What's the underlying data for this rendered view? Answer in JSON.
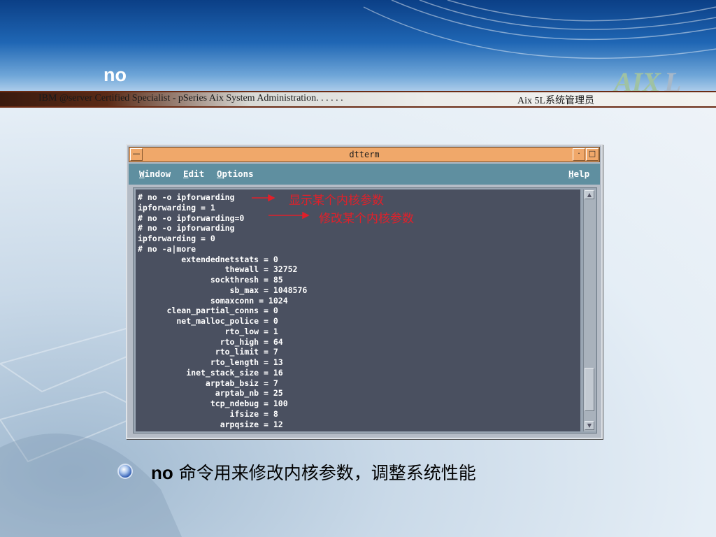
{
  "slide": {
    "title": "no",
    "logo_text": "AIX",
    "logo_suffix": "L",
    "banner_left": "IBM @server Certified Specialist - pSeries Aix System Administration. . . . . .",
    "banner_right": "Aix 5L系统管理员"
  },
  "window": {
    "title": "dtterm",
    "menus": [
      {
        "label": "Window",
        "mnemonic": "W",
        "rest": "indow"
      },
      {
        "label": "Edit",
        "mnemonic": "E",
        "rest": "dit"
      },
      {
        "label": "Options",
        "mnemonic": "O",
        "rest": "ptions"
      },
      {
        "label": "Help",
        "mnemonic": "H",
        "rest": "elp"
      }
    ],
    "terminal_lines": [
      "# no -o ipforwarding",
      "ipforwarding = 1",
      "# no -o ipforwarding=0",
      "# no -o ipforwarding",
      "ipforwarding = 0",
      "# no -a|more",
      "         extendednetstats = 0",
      "                  thewall = 32752",
      "               sockthresh = 85",
      "                   sb_max = 1048576",
      "               somaxconn = 1024",
      "      clean_partial_conns = 0",
      "        net_malloc_police = 0",
      "                  rto_low = 1",
      "                 rto_high = 64",
      "                rto_limit = 7",
      "               rto_length = 13",
      "          inet_stack_size = 16",
      "              arptab_bsiz = 7",
      "                arptab_nb = 25",
      "               tcp_ndebug = 100",
      "                   ifsize = 8",
      "                 arpqsize = 12"
    ]
  },
  "annotations": {
    "show_param": "显示某个内核参数",
    "modify_param": "修改某个内核参数",
    "color": "#e0202a"
  },
  "bullet": {
    "keyword": "no",
    "text": " 命令用来修改内核参数，调整系统性能"
  }
}
